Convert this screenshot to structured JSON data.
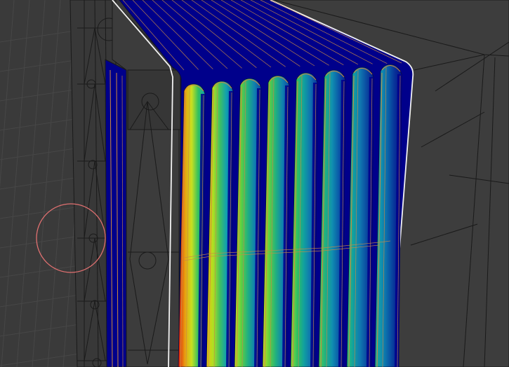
{
  "viewport": {
    "mode": "3d-viewport",
    "shading": "heatmap-wireframe",
    "colors": {
      "background": "#3a3a3a",
      "grid": "#474747",
      "wireframe": "#1a1a1a",
      "mesh_base": "#00008b",
      "seam": "#d08a3c",
      "selection_edge": "#f2f2f2",
      "brush_cursor": "#e07070",
      "heat_max": "#e01a0a",
      "heat_mid": "#c8e020",
      "heat_low": "#10b0a0"
    },
    "fins": [
      {
        "id": "fin-1",
        "heat": 1.0
      },
      {
        "id": "fin-2",
        "heat": 0.85
      },
      {
        "id": "fin-3",
        "heat": 0.72
      },
      {
        "id": "fin-4",
        "heat": 0.62
      },
      {
        "id": "fin-5",
        "heat": 0.52
      },
      {
        "id": "fin-6",
        "heat": 0.42
      },
      {
        "id": "fin-7",
        "heat": 0.34
      },
      {
        "id": "fin-8",
        "heat": 0.26
      }
    ],
    "icons": [
      "brush-cursor-icon"
    ]
  }
}
